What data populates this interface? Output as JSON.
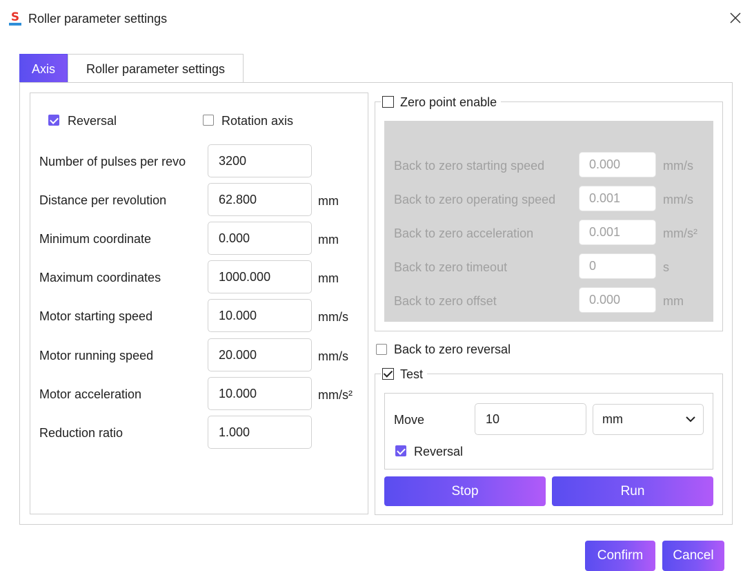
{
  "window": {
    "title": "Roller parameter settings",
    "icon": "app-logo-icon",
    "close_icon": "close-icon"
  },
  "tabs": [
    {
      "label": "Axis",
      "active": true
    },
    {
      "label": "Roller parameter settings",
      "active": false
    }
  ],
  "axis": {
    "reversal": {
      "label": "Reversal",
      "checked": true
    },
    "rotation_axis": {
      "label": "Rotation axis",
      "checked": false
    },
    "fields": [
      {
        "label": "Number of pulses per revo",
        "value": "3200",
        "unit": ""
      },
      {
        "label": "Distance per revolution",
        "value": "62.800",
        "unit": "mm"
      },
      {
        "label": "Minimum coordinate",
        "value": "0.000",
        "unit": "mm"
      },
      {
        "label": "Maximum coordinates",
        "value": "1000.000",
        "unit": "mm"
      },
      {
        "label": "Motor starting speed",
        "value": "10.000",
        "unit": "mm/s"
      },
      {
        "label": "Motor running speed",
        "value": "20.000",
        "unit": "mm/s"
      },
      {
        "label": "Motor acceleration",
        "value": "10.000",
        "unit": "mm/s²"
      },
      {
        "label": "Reduction ratio",
        "value": "1.000",
        "unit": ""
      }
    ]
  },
  "zero_point": {
    "enable": {
      "label": "Zero point enable",
      "checked": false
    },
    "fields": [
      {
        "label": "Back to zero starting speed",
        "value": "0.000",
        "unit": "mm/s"
      },
      {
        "label": "Back to zero operating speed",
        "value": "0.001",
        "unit": "mm/s"
      },
      {
        "label": "Back to zero acceleration",
        "value": "0.001",
        "unit": "mm/s²"
      },
      {
        "label": "Back to zero timeout",
        "value": "0",
        "unit": "s"
      },
      {
        "label": "Back to zero offset",
        "value": "0.000",
        "unit": "mm"
      }
    ],
    "reversal": {
      "label": "Back to zero reversal",
      "checked": false
    }
  },
  "test": {
    "enable": {
      "label": "Test",
      "checked": true
    },
    "move_label": "Move",
    "move_value": "10",
    "unit_selected": "mm",
    "reversal": {
      "label": "Reversal",
      "checked": true
    },
    "stop_label": "Stop",
    "run_label": "Run"
  },
  "footer": {
    "confirm_label": "Confirm",
    "cancel_label": "Cancel"
  },
  "colors": {
    "accent": "#6e5af0",
    "button_gradient_start": "#5a4df0",
    "button_gradient_end": "#b15af8",
    "disabled_panel": "#d5d5d5"
  }
}
